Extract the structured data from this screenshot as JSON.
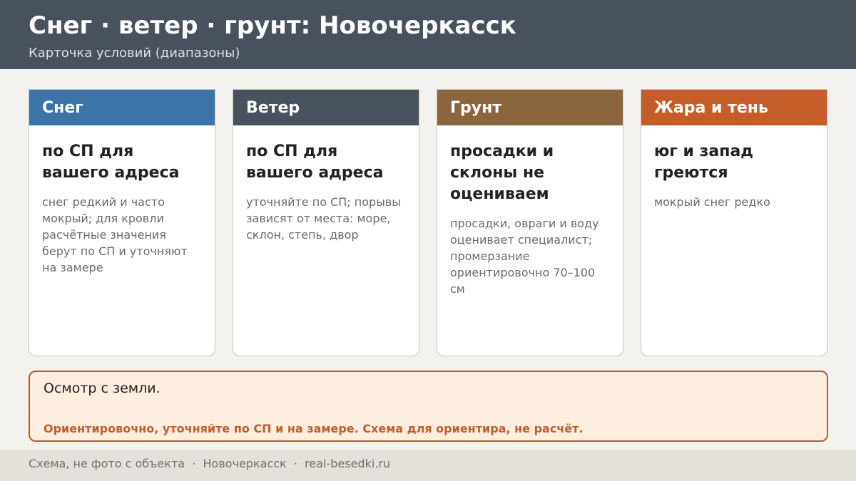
{
  "header": {
    "title": "Снег · ветер · грунт: Новочеркасск",
    "subtitle": "Карточка условий (диапазоны)"
  },
  "cards": [
    {
      "label": "Снег",
      "color": "#3d74a8",
      "main": "по СП для вашего адреса",
      "note": "снег редкий и часто мокрый; для кровли расчётные значения берут по СП и уточняют на замере"
    },
    {
      "label": "Ветер",
      "color": "#48525e",
      "main": "по СП для вашего адреса",
      "note": "уточняйте по СП; порывы зависят от места: море, склон, степь, двор"
    },
    {
      "label": "Грунт",
      "color": "#8b653d",
      "main": "просадки и склоны не оцениваем",
      "note": "просадки, овраги и воду оценивает специалист; промерзание ориентировочно 70–100 см"
    },
    {
      "label": "Жара и тень",
      "color": "#c45d27",
      "main": "юг и запад греются",
      "note": "мокрый снег редко"
    }
  ],
  "notice": {
    "text": "Осмотр с земли.",
    "warning": "Ориентировочно, уточняйте по СП и на замере. Схема для ориентира, не расчёт."
  },
  "footer": {
    "text": "Схема, не фото с объекта  ·  Новочеркасск  ·  real-besedki.ru"
  }
}
